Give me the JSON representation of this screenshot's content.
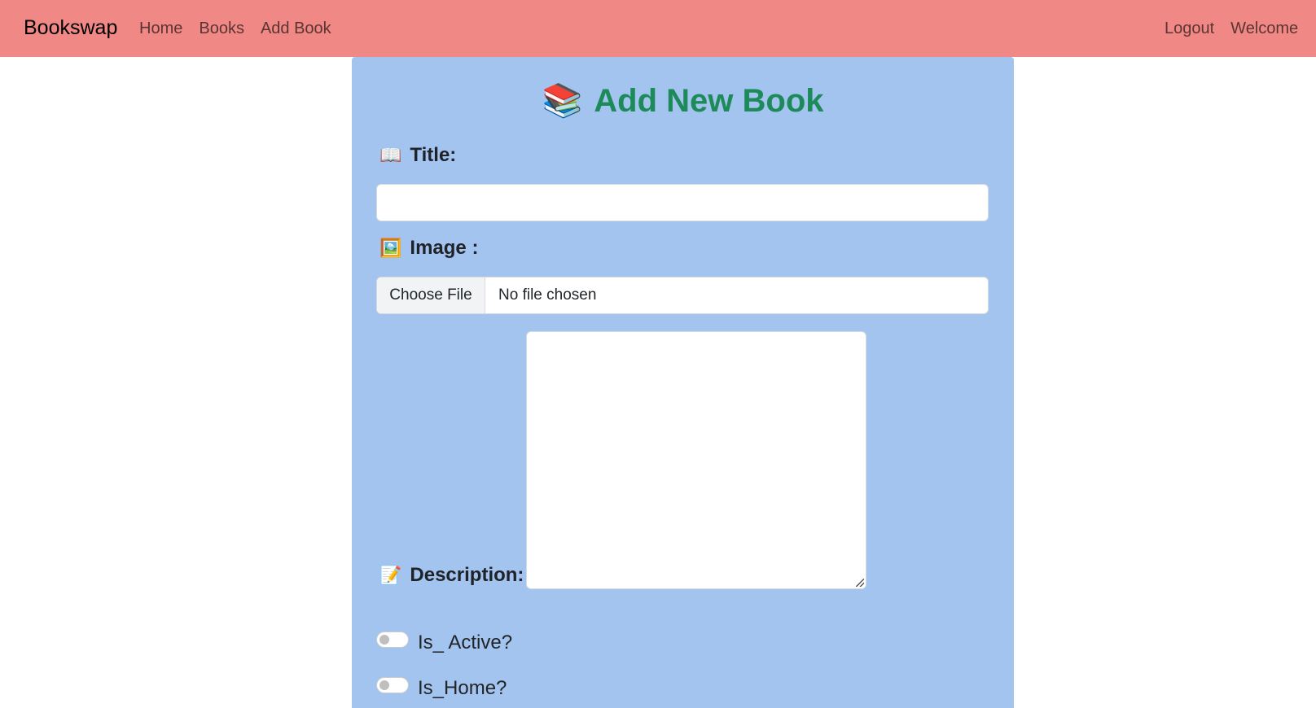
{
  "navbar": {
    "brand": "Bookswap",
    "links": [
      "Home",
      "Books",
      "Add Book"
    ],
    "right_links": [
      "Logout",
      "Welcome"
    ]
  },
  "form": {
    "heading": "Add New Book",
    "heading_emoji": "📚",
    "title_label": "Title:",
    "title_emoji": "📖",
    "title_value": "",
    "image_label": "Image :",
    "image_emoji": "🖼️",
    "file_button": "Choose File",
    "file_status": "No file chosen",
    "description_label": "Description:",
    "description_emoji": "📝",
    "description_value": "",
    "is_active_label": "Is_ Active?",
    "is_active_checked": false,
    "is_home_label": "Is_Home?",
    "is_home_checked": false
  },
  "colors": {
    "navbar_bg": "#f08885",
    "card_bg": "#a3c4ee",
    "heading": "#1d8a5a"
  }
}
